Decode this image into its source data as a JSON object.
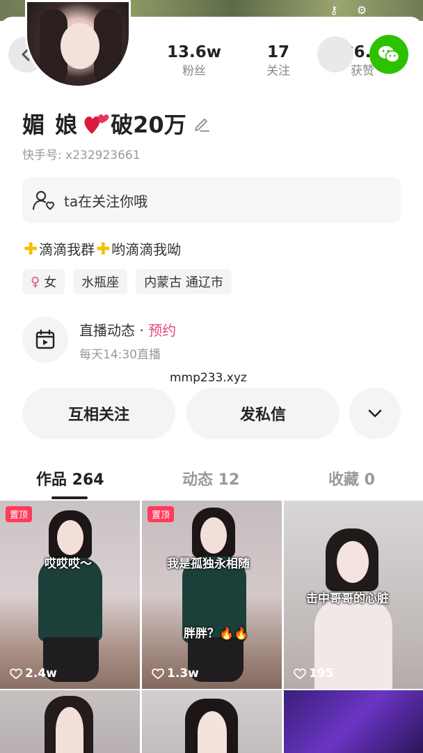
{
  "stats": [
    {
      "value": "13.6w",
      "label": "粉丝"
    },
    {
      "value": "17",
      "label": "关注"
    },
    {
      "value": "86.5",
      "label": "获赞"
    }
  ],
  "profile": {
    "name": "媚 娘",
    "name_suffix": "破20万",
    "kuaishou_id": "快手号: x232923661",
    "follow_notice": "ta在关注你哦",
    "bio_part1": "滴滴我群",
    "bio_part2": "哟滴滴我呦",
    "tags": [
      "女",
      "水瓶座",
      "内蒙古 通辽市"
    ]
  },
  "live": {
    "title": "直播动态 · ",
    "book": "预约",
    "schedule": "每天14:30直播"
  },
  "watermark": "mmp233.xyz",
  "actions": {
    "mutual_follow": "互相关注",
    "message": "发私信"
  },
  "tabs": [
    {
      "label": "作品 264"
    },
    {
      "label": "动态 12"
    },
    {
      "label": "收藏 0"
    }
  ],
  "works": [
    {
      "pin": "置顶",
      "caption": "哎哎哎～",
      "likes": "2.4w"
    },
    {
      "pin": "置顶",
      "caption": "我是孤独永相随",
      "caption2": "胖胖？🔥🔥",
      "likes": "1.3w"
    },
    {
      "caption": "击中哥哥的心脏",
      "likes": "195"
    }
  ],
  "colors": {
    "accent_pink": "#e2477c",
    "wechat_green": "#2dc100",
    "pin_red": "#ff3b5c"
  }
}
